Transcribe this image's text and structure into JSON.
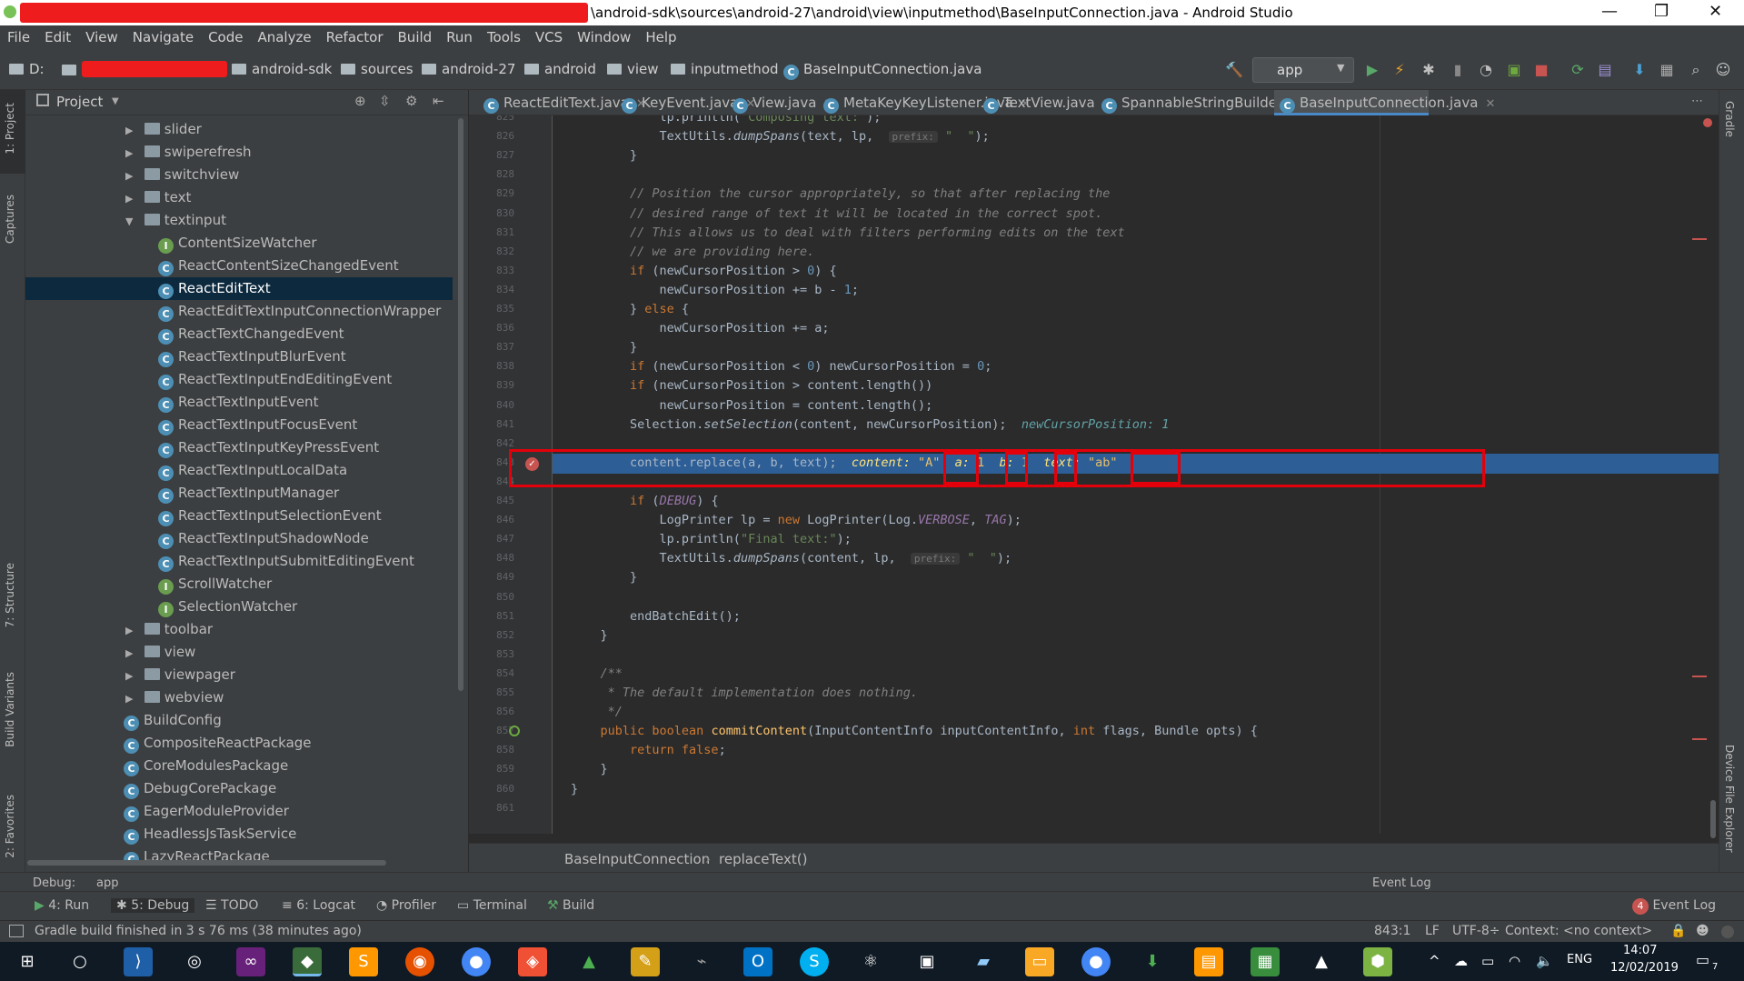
{
  "window": {
    "title_path": "\\android-sdk\\sources\\android-27\\android\\view\\inputmethod\\BaseInputConnection.java - Android Studio",
    "minimize": "—",
    "restore": "❐",
    "close": "✕"
  },
  "menu": [
    "File",
    "Edit",
    "View",
    "Navigate",
    "Code",
    "Analyze",
    "Refactor",
    "Build",
    "Run",
    "Tools",
    "VCS",
    "Window",
    "Help"
  ],
  "breadcrumb": {
    "drive": "D:",
    "items": [
      "android-sdk",
      "sources",
      "android-27",
      "android",
      "view",
      "inputmethod",
      "BaseInputConnection.java"
    ],
    "run_config": "app"
  },
  "left_strip": {
    "project": "1: Project",
    "captures": "Captures",
    "structure": "7: Structure",
    "build_variants": "Build Variants",
    "favorites": "2: Favorites"
  },
  "right_strip": {
    "gradle": "Gradle",
    "device_explorer": "Device File Explorer"
  },
  "project_panel": {
    "title": "Project",
    "tree": [
      {
        "label": "slider",
        "kind": "folder",
        "indent": 1,
        "expanded": false
      },
      {
        "label": "swiperefresh",
        "kind": "folder",
        "indent": 1,
        "expanded": false
      },
      {
        "label": "switchview",
        "kind": "folder",
        "indent": 1,
        "expanded": false
      },
      {
        "label": "text",
        "kind": "folder",
        "indent": 1,
        "expanded": false
      },
      {
        "label": "textinput",
        "kind": "folder",
        "indent": 1,
        "expanded": true
      },
      {
        "label": "ContentSizeWatcher",
        "kind": "interface",
        "indent": 2
      },
      {
        "label": "ReactContentSizeChangedEvent",
        "kind": "class",
        "indent": 2
      },
      {
        "label": "ReactEditText",
        "kind": "class",
        "indent": 2,
        "selected": true
      },
      {
        "label": "ReactEditTextInputConnectionWrapper",
        "kind": "class",
        "indent": 2
      },
      {
        "label": "ReactTextChangedEvent",
        "kind": "class",
        "indent": 2
      },
      {
        "label": "ReactTextInputBlurEvent",
        "kind": "class",
        "indent": 2
      },
      {
        "label": "ReactTextInputEndEditingEvent",
        "kind": "class",
        "indent": 2
      },
      {
        "label": "ReactTextInputEvent",
        "kind": "class",
        "indent": 2
      },
      {
        "label": "ReactTextInputFocusEvent",
        "kind": "class",
        "indent": 2
      },
      {
        "label": "ReactTextInputKeyPressEvent",
        "kind": "class",
        "indent": 2
      },
      {
        "label": "ReactTextInputLocalData",
        "kind": "class",
        "indent": 2
      },
      {
        "label": "ReactTextInputManager",
        "kind": "class",
        "indent": 2
      },
      {
        "label": "ReactTextInputSelectionEvent",
        "kind": "class",
        "indent": 2
      },
      {
        "label": "ReactTextInputShadowNode",
        "kind": "class",
        "indent": 2
      },
      {
        "label": "ReactTextInputSubmitEditingEvent",
        "kind": "class",
        "indent": 2
      },
      {
        "label": "ScrollWatcher",
        "kind": "interface",
        "indent": 2
      },
      {
        "label": "SelectionWatcher",
        "kind": "interface",
        "indent": 2
      },
      {
        "label": "toolbar",
        "kind": "folder",
        "indent": 1,
        "expanded": false
      },
      {
        "label": "view",
        "kind": "folder",
        "indent": 1,
        "expanded": false
      },
      {
        "label": "viewpager",
        "kind": "folder",
        "indent": 1,
        "expanded": false
      },
      {
        "label": "webview",
        "kind": "folder",
        "indent": 1,
        "expanded": false
      },
      {
        "label": "BuildConfig",
        "kind": "class",
        "indent": 0
      },
      {
        "label": "CompositeReactPackage",
        "kind": "class",
        "indent": 0
      },
      {
        "label": "CoreModulesPackage",
        "kind": "class",
        "indent": 0
      },
      {
        "label": "DebugCorePackage",
        "kind": "class",
        "indent": 0
      },
      {
        "label": "EagerModuleProvider",
        "kind": "class",
        "indent": 0
      },
      {
        "label": "HeadlessJsTaskService",
        "kind": "class",
        "indent": 0
      },
      {
        "label": "LazyReactPackage",
        "kind": "class",
        "indent": 0
      }
    ]
  },
  "tabs": [
    {
      "label": "ReactEditText.java"
    },
    {
      "label": "KeyEvent.java"
    },
    {
      "label": "View.java"
    },
    {
      "label": "MetaKeyKeyListener.java"
    },
    {
      "label": "TextView.java"
    },
    {
      "label": "SpannableStringBuilder.java"
    },
    {
      "label": "BaseInputConnection.java",
      "active": true
    }
  ],
  "code_lines": [
    {
      "n": "825",
      "html": "            lp.println(<span class=\"st\">\"Composing text:\"</span>);"
    },
    {
      "n": "826",
      "html": "            TextUtils.<span class=\"it\">dumpSpans</span>(text, lp,  <span class=\"hint\">prefix:</span> <span class=\"st\">\"  \"</span>);"
    },
    {
      "n": "827",
      "html": "        }"
    },
    {
      "n": "828",
      "html": ""
    },
    {
      "n": "829",
      "html": "        <span class=\"cm\">// Position the cursor appropriately, so that after replacing the</span>"
    },
    {
      "n": "830",
      "html": "        <span class=\"cm\">// desired range of text it will be located in the correct spot.</span>"
    },
    {
      "n": "831",
      "html": "        <span class=\"cm\">// This allows us to deal with filters performing edits on the text</span>"
    },
    {
      "n": "832",
      "html": "        <span class=\"cm\">// we are providing here.</span>"
    },
    {
      "n": "833",
      "html": "        <span class=\"kw\">if</span> (newCursorPosition > <span class=\"nm\">0</span>) {"
    },
    {
      "n": "834",
      "html": "            newCursorPosition += b - <span class=\"nm\">1</span>;"
    },
    {
      "n": "835",
      "html": "        } <span class=\"kw\">else</span> {"
    },
    {
      "n": "836",
      "html": "            newCursorPosition += a;"
    },
    {
      "n": "837",
      "html": "        }"
    },
    {
      "n": "838",
      "html": "        <span class=\"kw\">if</span> (newCursorPosition < <span class=\"nm\">0</span>) newCursorPosition = <span class=\"nm\">0</span>;"
    },
    {
      "n": "839",
      "html": "        <span class=\"kw\">if</span> (newCursorPosition > content.length())"
    },
    {
      "n": "840",
      "html": "            newCursorPosition = content.length();"
    },
    {
      "n": "841",
      "html": "        Selection.<span class=\"it\">setSelection</span>(content, newCursorPosition);  <span class=\"inl\">newCursorPosition: 1</span>"
    },
    {
      "n": "842",
      "html": ""
    },
    {
      "n": "843",
      "html": "        content.replace(a, b, text);  <span class=\"inl\" style=\"color:#ffe27a\">content: </span><span class=\"st\" style=\"color:#e8bf6a\">\"A\"</span>  <span class=\"inl\" style=\"color:#ffe27a\">a: </span><span style=\"color:#e8bf6a\">1</span>  <span class=\"inl\" style=\"color:#ffe27a\">b: </span><span style=\"color:#e8bf6a\">1</span>  <span class=\"inl\" style=\"color:#ffe27a\">text: </span><span style=\"color:#e8bf6a\">\"ab\"</span>",
      "exec": true
    },
    {
      "n": "844",
      "html": ""
    },
    {
      "n": "845",
      "html": "        <span class=\"kw\">if</span> (<span class=\"it\" style=\"color:#9876aa\">DEBUG</span>) {"
    },
    {
      "n": "846",
      "html": "            LogPrinter lp = <span class=\"kw\">new</span> LogPrinter(Log.<span class=\"it\" style=\"color:#9876aa\">VERBOSE</span>, <span class=\"it\" style=\"color:#9876aa\">TAG</span>);"
    },
    {
      "n": "847",
      "html": "            lp.println(<span class=\"st\">\"Final text:\"</span>);"
    },
    {
      "n": "848",
      "html": "            TextUtils.<span class=\"it\">dumpSpans</span>(content, lp,  <span class=\"hint\">prefix:</span> <span class=\"st\">\"  \"</span>);"
    },
    {
      "n": "849",
      "html": "        }"
    },
    {
      "n": "850",
      "html": ""
    },
    {
      "n": "851",
      "html": "        endBatchEdit();"
    },
    {
      "n": "852",
      "html": "    }"
    },
    {
      "n": "853",
      "html": ""
    },
    {
      "n": "854",
      "html": "    <span class=\"cm\">/**</span>"
    },
    {
      "n": "855",
      "html": "<span class=\"cm\">     * The default implementation does nothing.</span>"
    },
    {
      "n": "856",
      "html": "<span class=\"cm\">     */</span>"
    },
    {
      "n": "857",
      "html": "    <span class=\"kw\">public boolean</span> <span class=\"fn\">commitContent</span>(InputContentInfo inputContentInfo, <span class=\"kw\">int</span> flags, Bundle opts) {"
    },
    {
      "n": "858",
      "html": "        <span class=\"kw\">return false</span>;"
    },
    {
      "n": "859",
      "html": "    }"
    },
    {
      "n": "860",
      "html": "}"
    },
    {
      "n": "861",
      "html": ""
    }
  ],
  "editor_breadcrumb": {
    "class": "BaseInputConnection",
    "method": "replaceText()"
  },
  "debug_bar": {
    "label": "Debug:",
    "config": "app",
    "event_log_label": "Event Log"
  },
  "tool_windows": [
    {
      "label": "4: Run"
    },
    {
      "label": "5: Debug"
    },
    {
      "label": "TODO"
    },
    {
      "label": "6: Logcat"
    },
    {
      "label": "Profiler"
    },
    {
      "label": "Terminal"
    },
    {
      "label": "Build"
    }
  ],
  "event_log": {
    "count": "4",
    "label": "Event Log"
  },
  "status": {
    "message": "Gradle build finished in 3 s 76 ms (38 minutes ago)",
    "position": "843:1",
    "line_sep": "LF",
    "encoding": "UTF-8÷",
    "context": "Context: <no context>"
  },
  "taskbar": {
    "lang": "ENG",
    "time": "14:07",
    "date": "12/02/2019",
    "notifications": "7"
  },
  "colors": {
    "accent": "#2d5e96",
    "breakpoint": "#c75450",
    "highlight_box": "#e4000b"
  }
}
